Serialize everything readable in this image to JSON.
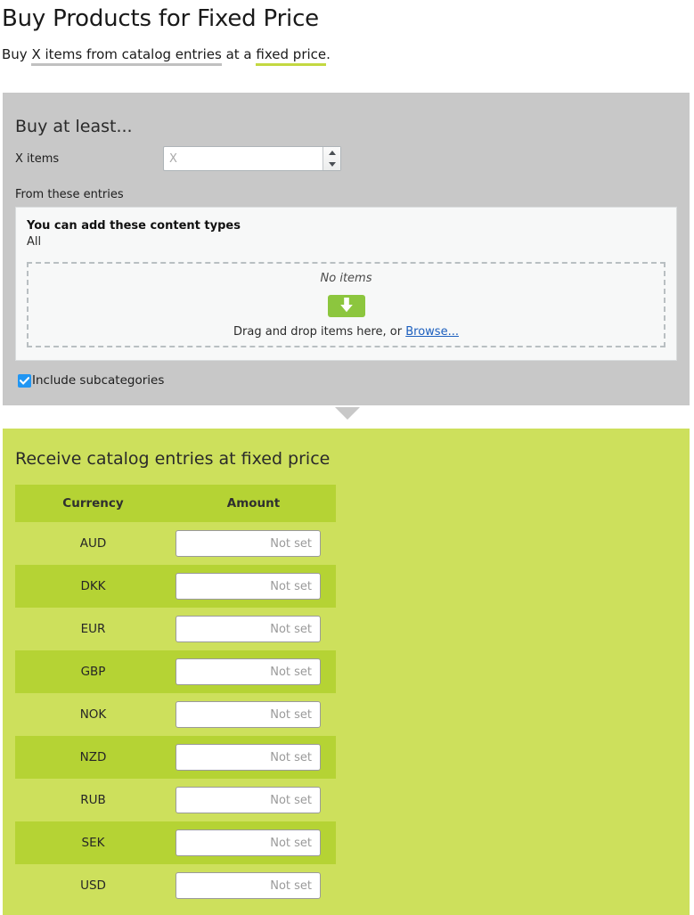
{
  "page": {
    "title": "Buy Products for Fixed Price",
    "subtitle": {
      "lead": "Buy",
      "segment_gray": "X items from catalog entries",
      "middle": "at a",
      "segment_green": "fixed price",
      "period": "."
    }
  },
  "condition_panel": {
    "title": "Buy at least...",
    "x_items": {
      "label": "X items",
      "value": "",
      "placeholder": "X"
    },
    "entries_label": "From these entries",
    "content_types": {
      "heading": "You can add these content types",
      "value": "All"
    },
    "dropzone": {
      "empty_text": "No items",
      "icon": "download-arrow-icon",
      "hint_text": "Drag and drop items here, or",
      "browse_label": "Browse..."
    },
    "include_subcategories": {
      "label": "Include subcategories",
      "checked": true
    }
  },
  "reward_panel": {
    "title": "Receive catalog entries at fixed price",
    "table": {
      "columns": [
        "Currency",
        "Amount"
      ],
      "amount_placeholder": "Not set",
      "rows": [
        {
          "currency": "AUD",
          "amount": ""
        },
        {
          "currency": "DKK",
          "amount": ""
        },
        {
          "currency": "EUR",
          "amount": ""
        },
        {
          "currency": "GBP",
          "amount": ""
        },
        {
          "currency": "NOK",
          "amount": ""
        },
        {
          "currency": "NZD",
          "amount": ""
        },
        {
          "currency": "RUB",
          "amount": ""
        },
        {
          "currency": "SEK",
          "amount": ""
        },
        {
          "currency": "USD",
          "amount": ""
        }
      ]
    }
  },
  "colors": {
    "panel_gray": "#c8c8c8",
    "panel_green": "#cde05c",
    "table_header_green": "#b5d334",
    "accent_green": "#8cc63e",
    "checkbox_blue": "#2196f3",
    "link_blue": "#1c5fbe"
  }
}
